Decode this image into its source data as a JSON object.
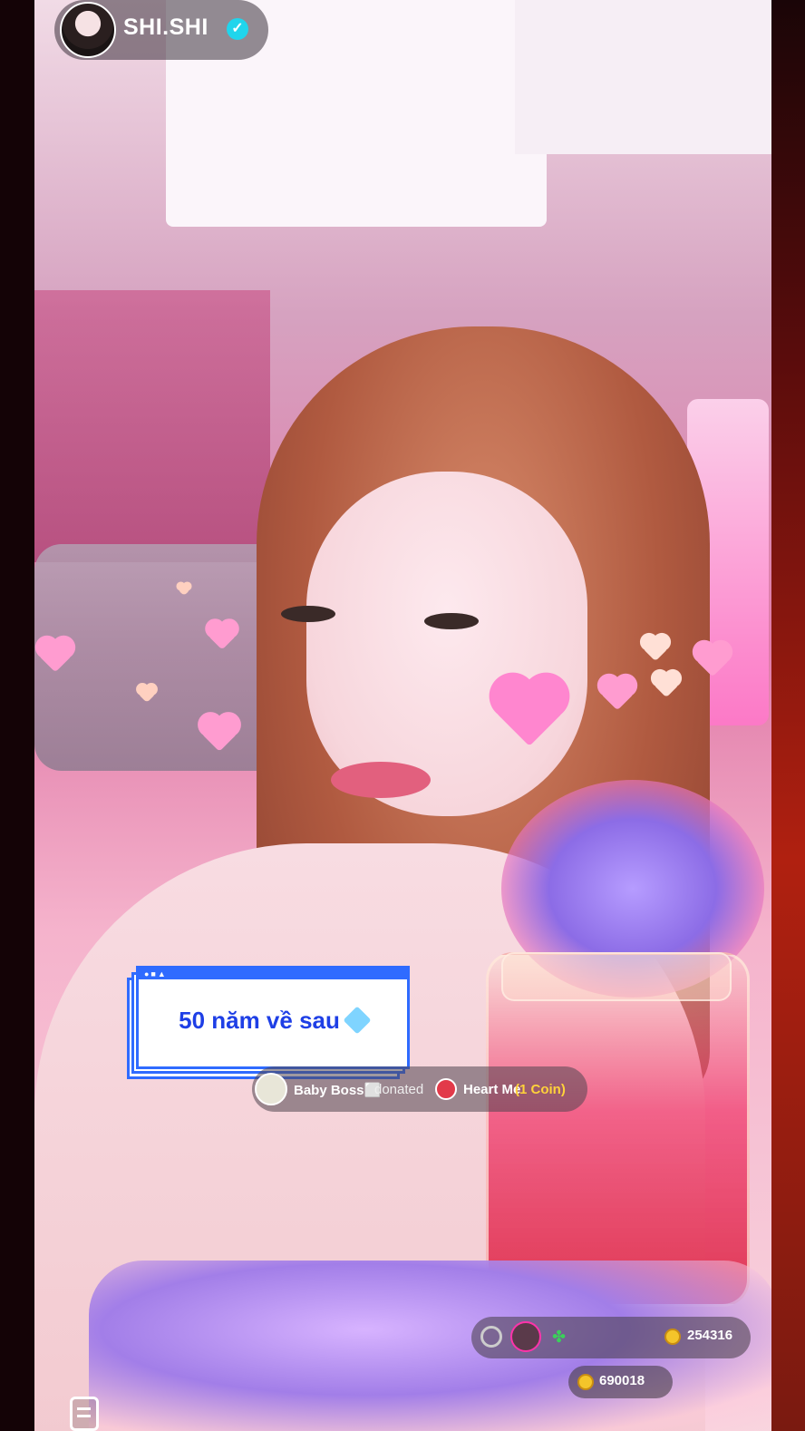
{
  "host": {
    "name": "SHI.SHI",
    "verified_icon": "verified-check-icon"
  },
  "caption": {
    "text": "50 năm về sau"
  },
  "donation": {
    "donor_name": "Baby Boss⬜",
    "action": "donated",
    "gift_name": "Heart Me",
    "gift_cost": "(1 Coin)"
  },
  "coins": {
    "top_value": "254316",
    "bottom_value": "690018"
  },
  "colors": {
    "caption_border": "#2f6bff",
    "caption_text": "#1e3fe6",
    "verified": "#20d5ec",
    "coin": "#f4c52a"
  }
}
